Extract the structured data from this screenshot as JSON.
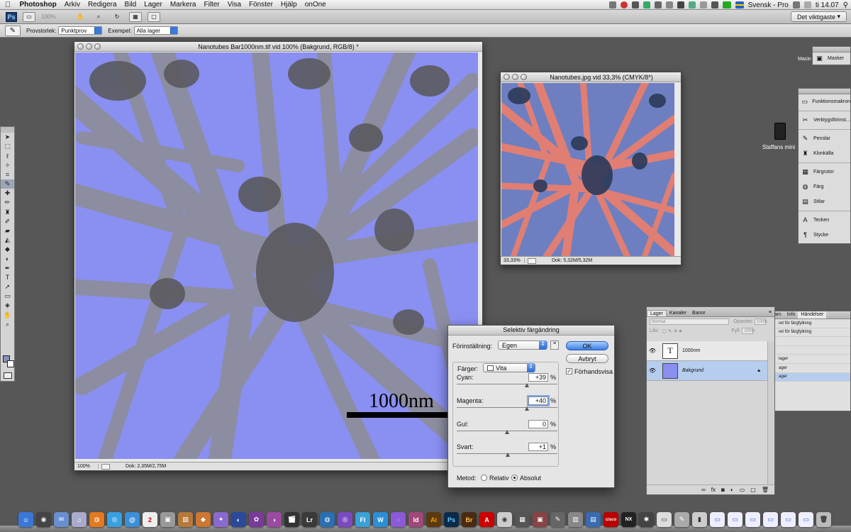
{
  "menubar": {
    "app": "Photoshop",
    "items": [
      "Arkiv",
      "Redigera",
      "Bild",
      "Lager",
      "Markera",
      "Filter",
      "Visa",
      "Fönster",
      "Hjälp",
      "onOne"
    ],
    "status": {
      "language": "Svensk - Pro",
      "clock": "ti 14.07"
    }
  },
  "appbar": {
    "logo": "Ps",
    "zoom": "100%",
    "workspace": "Det viktigaste"
  },
  "options": {
    "sample_size_label": "Provstorlek:",
    "sample_size_value": "Punktprov",
    "sample_label": "Exempel:",
    "sample_value": "Alla lager"
  },
  "main_doc": {
    "title": "Nanotubes Bar1000nm.tif vid 100% (Bakgrund, RGB/8) *",
    "scale_label": "1000nm",
    "zoom": "100%",
    "doc_info": "Dok: 2,35M/2,75M"
  },
  "second_doc": {
    "title": "Nanotubes.jpg vid 33,3% (CMYK/8*)",
    "zoom": "33,33%",
    "doc_info": "Dok: 5,32M/5,32M"
  },
  "dock_panels": {
    "masker": "Masker",
    "macin_label": "Macin",
    "items": [
      "Funktionsmakron",
      "Verktygsförinst...",
      "Penslar",
      "Klonkälla",
      "Färgrutor",
      "Färg",
      "Stilar",
      "Tecken",
      "Stycke"
    ]
  },
  "desktop": {
    "drive_label": "Staffans mini"
  },
  "layers": {
    "tabs": [
      "Lager",
      "Kanaler",
      "Banor"
    ],
    "blend_mode": "Normal",
    "opacity_label": "Opacitet:",
    "opacity_value": "100%",
    "lock_label": "Lås:",
    "fill_label": "Fyll:",
    "fill_value": "100%",
    "items": [
      {
        "name": "1000nm",
        "thumb": "T"
      },
      {
        "name": "Bakgrund"
      }
    ]
  },
  "history": {
    "tabs": [
      "am",
      "Info",
      "Händelser"
    ],
    "items": [
      "ret för färgfyllning",
      "ret för färgfyllning",
      "",
      "",
      "lager",
      "ager",
      "ager"
    ]
  },
  "dialog": {
    "title": "Selektiv färgändring",
    "preset_label": "Förinställning:",
    "preset_value": "Egen",
    "colors_label": "Färger:",
    "colors_value": "Vita",
    "sliders": [
      {
        "label": "Cyan:",
        "value": "+39",
        "pos": 69.5
      },
      {
        "label": "Magenta:",
        "value": "+40",
        "pos": 70
      },
      {
        "label": "Gul:",
        "value": "0",
        "pos": 50
      },
      {
        "label": "Svart:",
        "value": "+1",
        "pos": 50.5
      }
    ],
    "pct": "%",
    "ok": "OK",
    "cancel": "Avbryt",
    "preview": "Förhandsvisa",
    "method_label": "Metod:",
    "method_relative": "Relativ",
    "method_absolute": "Absolut"
  }
}
